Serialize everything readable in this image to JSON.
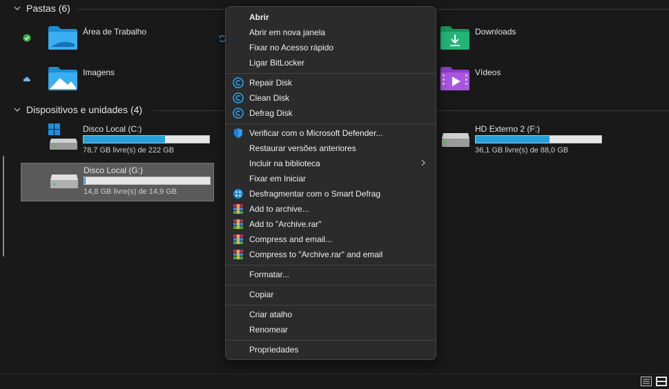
{
  "groups": {
    "folders_header": "Pastas (6)",
    "devices_header": "Dispositivos e unidades (4)"
  },
  "folders": [
    {
      "label": "Área de Trabalho"
    },
    {
      "label": "Downloads"
    },
    {
      "label": "Imagens"
    },
    {
      "label": "Vídeos"
    }
  ],
  "drives": [
    {
      "name": "Disco Local (C:)",
      "free": "78,7 GB livre(s) de 222 GB",
      "used_fraction": 0.65
    },
    {
      "name": "HD Externo 2 (F:)",
      "free": "36,1 GB livre(s) de 88,0 GB",
      "used_fraction": 0.59
    },
    {
      "name": "Disco Local (G:)",
      "free": "14,8 GB livre(s) de 14,9 GB",
      "used_fraction": 0.01
    }
  ],
  "menu": {
    "abrir": "Abrir",
    "nova_janela": "Abrir em nova janela",
    "fixar_acesso": "Fixar no Acesso rápido",
    "bitlocker": "Ligar BitLocker",
    "repair": "Repair Disk",
    "clean": "Clean Disk",
    "defrag": "Defrag Disk",
    "defender": "Verificar com o Microsoft Defender...",
    "restaurar": "Restaurar versões anteriores",
    "biblioteca": "Incluir na biblioteca",
    "fixar_iniciar": "Fixar em Iniciar",
    "smart_defrag": "Desfragmentar com o Smart Defrag",
    "add_archive": "Add to archive...",
    "add_rar": "Add to \"Archive.rar\"",
    "compress_email": "Compress and email...",
    "compress_rar_email": "Compress to \"Archive.rar\" and email",
    "formatar": "Formatar...",
    "copiar": "Copiar",
    "criar_atalho": "Criar atalho",
    "renomear": "Renomear",
    "propriedades": "Propriedades"
  },
  "colors": {
    "accent": "#26a0da",
    "background": "#191919",
    "menu_bg": "#2b2b2b",
    "selected": "#5a5a5a"
  }
}
